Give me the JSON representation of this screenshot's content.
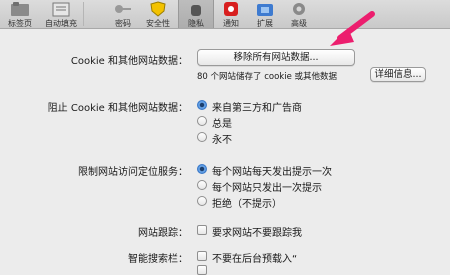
{
  "toolbar": {
    "tabs": [
      {
        "label": "标签页"
      },
      {
        "label": "自动填充"
      },
      {
        "label": "密码"
      },
      {
        "label": "安全性"
      },
      {
        "label": "隐私"
      },
      {
        "label": "通知"
      },
      {
        "label": "扩展"
      },
      {
        "label": "高级"
      }
    ],
    "active_tab": "隐私"
  },
  "cookies": {
    "label": "Cookie 和其他网站数据：",
    "remove_button": "移除所有网站数据...",
    "info_text": "80 个网站储存了 cookie 或其他数据",
    "details_button": "详细信息..."
  },
  "block": {
    "label": "阻止 Cookie 和其他网站数据：",
    "options": [
      "来自第三方和广告商",
      "总是",
      "永不"
    ],
    "selected": "来自第三方和广告商"
  },
  "location": {
    "label": "限制网站访问定位服务：",
    "options": [
      "每个网站每天发出提示一次",
      "每个网站只发出一次提示",
      "拒绝（不提示）"
    ],
    "selected": "每个网站每天发出提示一次"
  },
  "tracking": {
    "label": "网站跟踪：",
    "checkbox_label": "要求网站不要跟踪我"
  },
  "smart_search": {
    "label": "智能搜索栏：",
    "checkbox_label": "不要在后台预载入“"
  },
  "colors": {
    "selection_blue": "#3c82d6",
    "arrow_pink": "#ec1e6e"
  }
}
